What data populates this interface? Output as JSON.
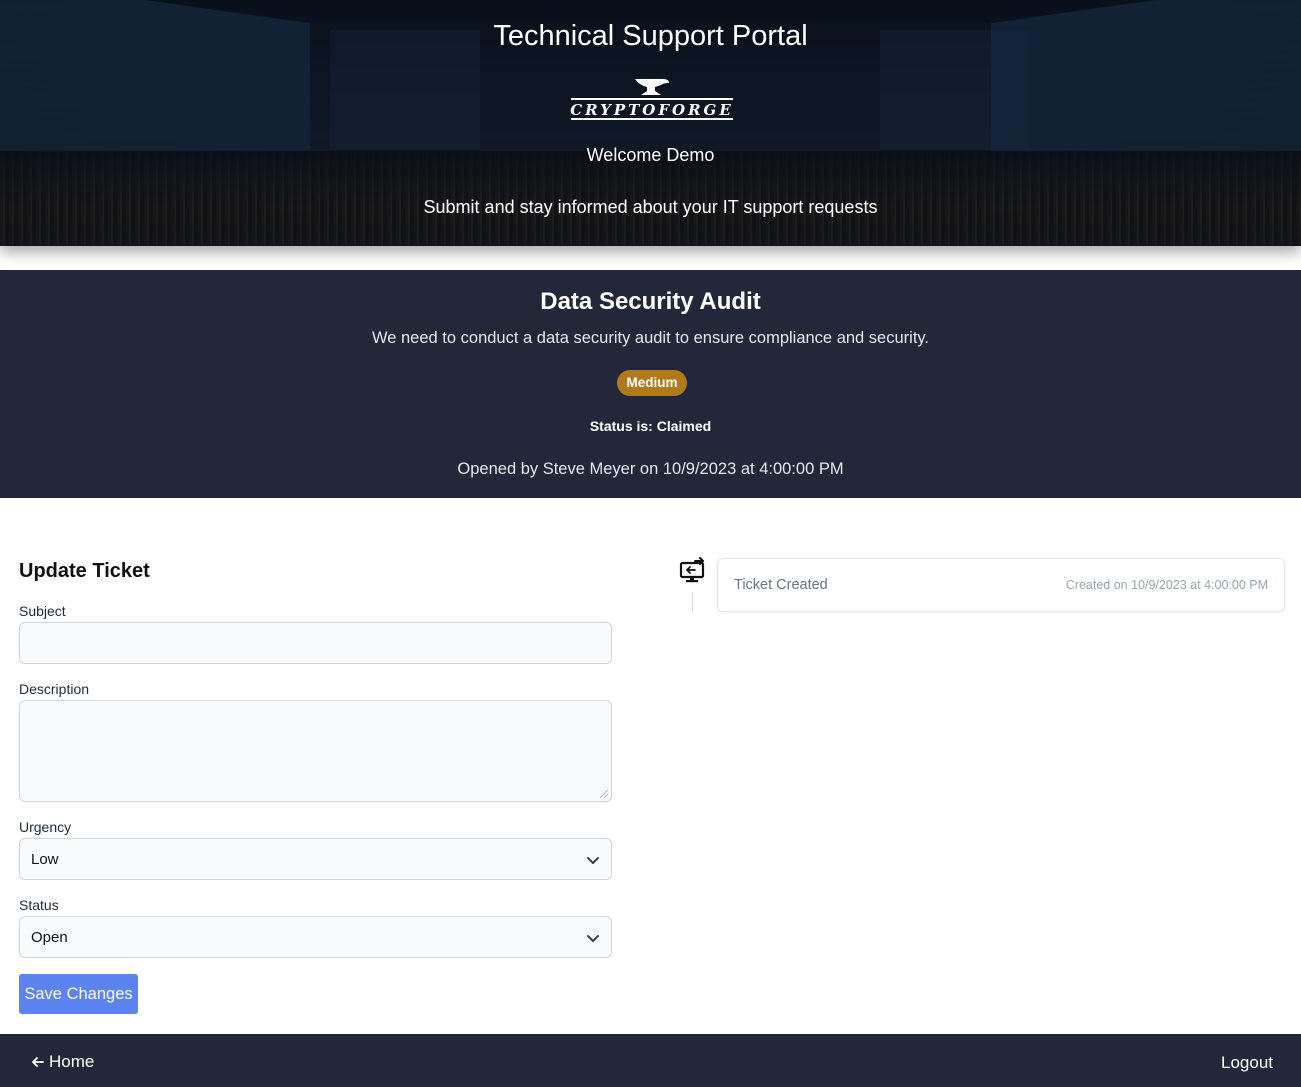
{
  "header": {
    "title": "Technical Support Portal",
    "logo_text": "CRYPTOFORGE",
    "welcome": "Welcome Demo",
    "tagline": "Submit and stay informed about your IT support requests"
  },
  "ticket": {
    "subject": "Data Security Audit",
    "description": "We need to conduct a data security audit to ensure compliance and security.",
    "urgency_badge": "Medium",
    "urgency_color": "#b07a1c",
    "status_line": "Status is: Claimed",
    "opened_line": "Opened by Steve Meyer on 10/9/2023 at 4:00:00 PM"
  },
  "form": {
    "title": "Update Ticket",
    "subject_label": "Subject",
    "subject_value": "",
    "description_label": "Description",
    "description_value": "",
    "urgency_label": "Urgency",
    "urgency_value": "Low",
    "status_label": "Status",
    "status_value": "Open",
    "save_label": "Save Changes"
  },
  "timeline": {
    "icon": "monitor-sync-icon",
    "events": [
      {
        "label": "Ticket Created",
        "when": "Created on 10/9/2023 at 4:00:00 PM"
      }
    ]
  },
  "footer": {
    "home_label": "Home",
    "logout_label": "Logout"
  },
  "colors": {
    "dark_panel": "#222839",
    "primary_button": "#5b84f1"
  }
}
